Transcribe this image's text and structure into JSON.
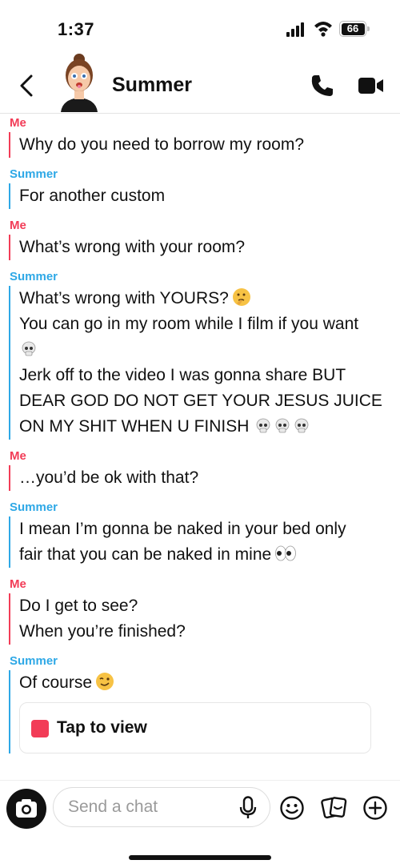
{
  "status": {
    "time": "1:37",
    "battery_level": "66"
  },
  "header": {
    "title": "Summer",
    "back_icon": "chevron-left-icon",
    "call_icon": "phone-icon",
    "video_icon": "video-camera-icon"
  },
  "messages": [
    {
      "sender": "Me",
      "lines": [
        "Why do you need to borrow my room?"
      ]
    },
    {
      "sender": "Summer",
      "lines": [
        "For another custom"
      ]
    },
    {
      "sender": "Me",
      "lines": [
        "What’s wrong with your room?"
      ]
    },
    {
      "sender": "Summer",
      "lines": [
        "What’s wrong with YOURS?",
        "You can go in my room while I film if you want",
        "Jerk off to the video I was gonna share BUT",
        "DEAR GOD DO NOT GET YOUR JESUS JUICE",
        "ON MY SHIT WHEN U FINISH"
      ]
    },
    {
      "sender": "Me",
      "lines": [
        "…you’d be ok with that?"
      ]
    },
    {
      "sender": "Summer",
      "lines": [
        "I mean I’m gonna be naked in your bed only",
        "fair that you can be naked in mine"
      ]
    },
    {
      "sender": "Me",
      "lines": [
        "Do I get to see?",
        "When you’re finished?"
      ]
    },
    {
      "sender": "Summer",
      "lines": [
        "Of course"
      ]
    }
  ],
  "snap": {
    "label": "Tap to view"
  },
  "composer": {
    "placeholder": "Send a chat"
  },
  "colors": {
    "me": "#f23c57",
    "friend": "#2ea8e6"
  }
}
